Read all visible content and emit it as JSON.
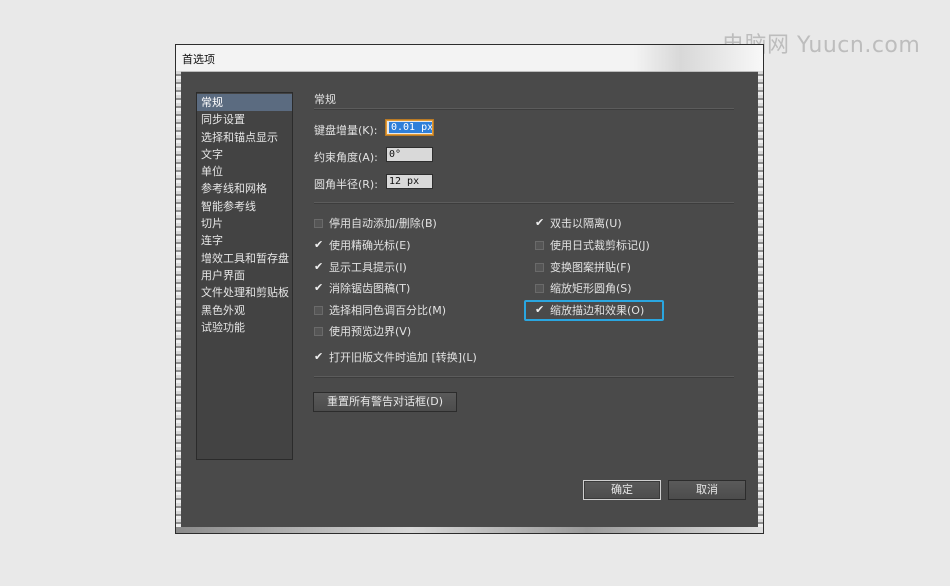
{
  "watermark": "电脑网 Yuucn.com",
  "window": {
    "title": "首选项"
  },
  "sidebar": {
    "items": [
      {
        "label": "常规",
        "selected": true
      },
      {
        "label": "同步设置"
      },
      {
        "label": "选择和锚点显示"
      },
      {
        "label": "文字"
      },
      {
        "label": "单位"
      },
      {
        "label": "参考线和网格"
      },
      {
        "label": "智能参考线"
      },
      {
        "label": "切片"
      },
      {
        "label": "连字"
      },
      {
        "label": "增效工具和暂存盘"
      },
      {
        "label": "用户界面"
      },
      {
        "label": "文件处理和剪贴板"
      },
      {
        "label": "黑色外观"
      },
      {
        "label": "试验功能"
      }
    ]
  },
  "general": {
    "section_title": "常规",
    "keyboard_increment_label": "键盘增量(K):",
    "keyboard_increment_value": "0.01 px",
    "constrain_angle_label": "约束角度(A):",
    "constrain_angle_value": "0°",
    "corner_radius_label": "圆角半径(R):",
    "corner_radius_value": "12 px"
  },
  "options_left": [
    {
      "label": "停用自动添加/删除(B)",
      "checked": false
    },
    {
      "label": "使用精确光标(E)",
      "checked": true
    },
    {
      "label": "显示工具提示(I)",
      "checked": true
    },
    {
      "label": "消除锯齿图稿(T)",
      "checked": true
    },
    {
      "label": "选择相同色调百分比(M)",
      "checked": false
    },
    {
      "label": "使用预览边界(V)",
      "checked": false
    }
  ],
  "options_right": [
    {
      "label": "双击以隔离(U)",
      "checked": true
    },
    {
      "label": "使用日式裁剪标记(J)",
      "checked": false
    },
    {
      "label": "变换图案拼贴(F)",
      "checked": false
    },
    {
      "label": "缩放矩形圆角(S)",
      "checked": false
    },
    {
      "label": "缩放描边和效果(O)",
      "checked": true
    }
  ],
  "option_legacy": {
    "label": "打开旧版文件时追加 [转换](L)",
    "checked": true
  },
  "buttons": {
    "reset_warnings": "重置所有警告对话框(D)",
    "ok": "确定",
    "cancel": "取消"
  },
  "colors": {
    "highlight": "#2aa6e0",
    "dialog_bg": "#4a4a4a",
    "selection": "#5b6b80"
  }
}
